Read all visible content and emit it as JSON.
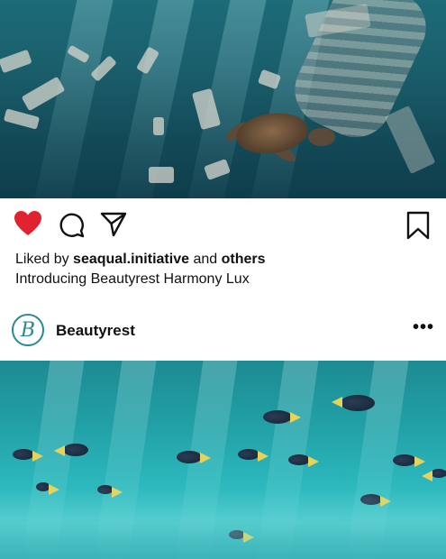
{
  "post": {
    "top_image_alt": "",
    "liked_prefix": "Liked by",
    "liked_user": "seaqual.initiative",
    "liked_and": "and",
    "liked_others": "others",
    "caption": "Introducing Beautyrest Harmony Lux",
    "liked": true
  },
  "account": {
    "username": "Beautyrest",
    "avatar_letter": "B"
  },
  "icons": {
    "like": "heart-icon",
    "comment": "comment-icon",
    "share": "share-icon",
    "save": "bookmark-icon",
    "more": "more-icon"
  },
  "colors": {
    "heart": "#e0242f",
    "avatar_brand": "#2a8a8f"
  }
}
